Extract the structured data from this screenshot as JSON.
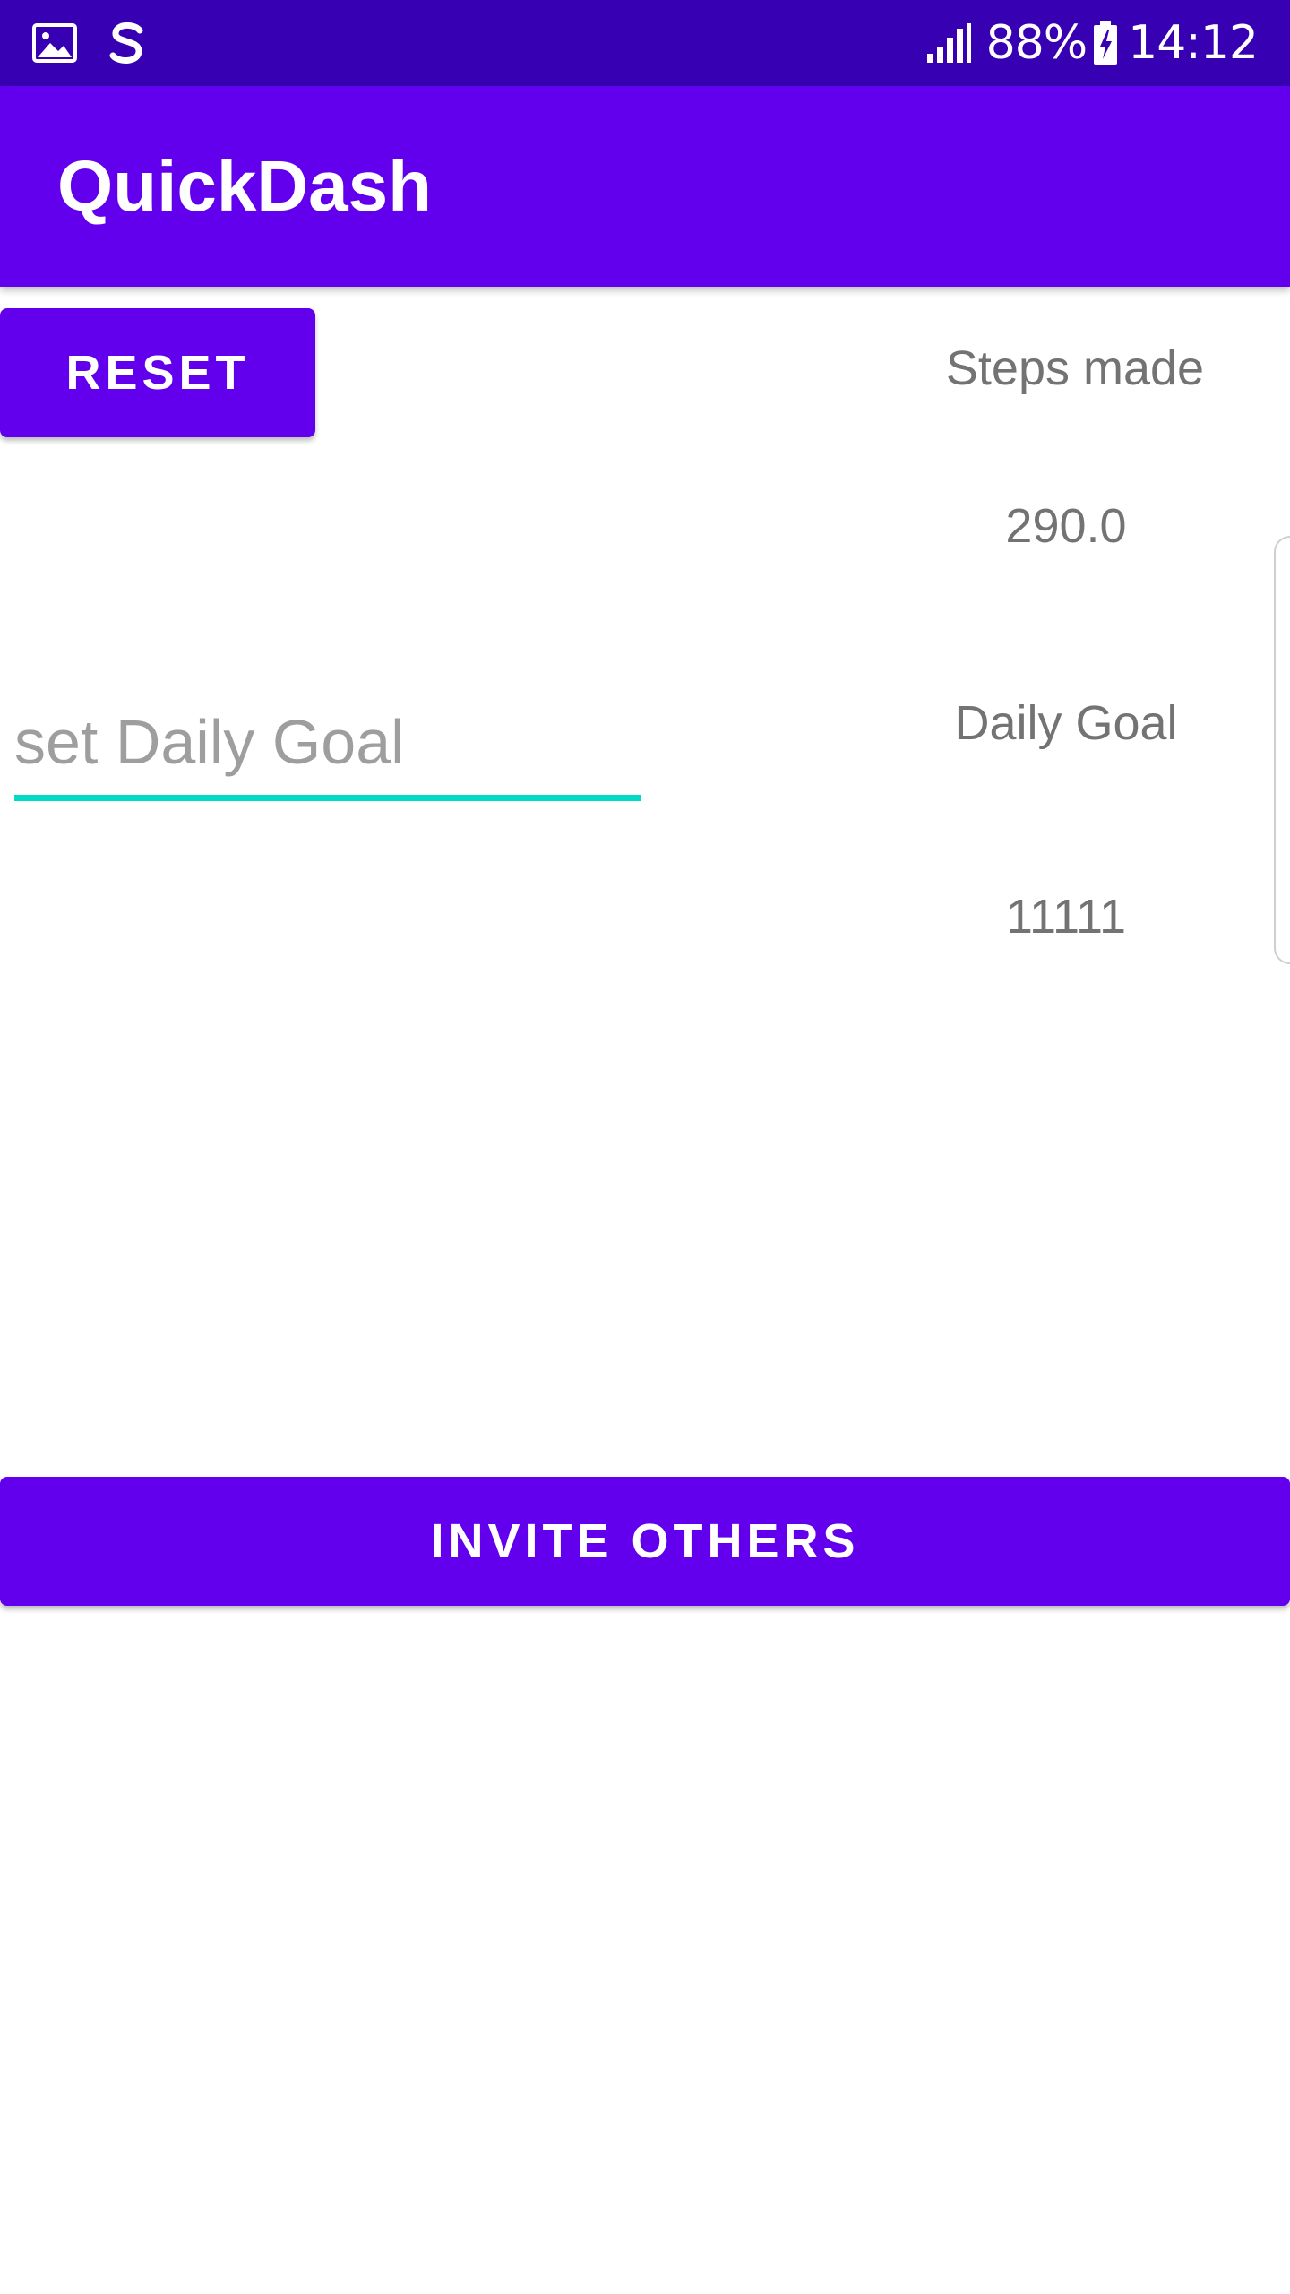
{
  "status_bar": {
    "battery_percent": "88%",
    "time": "14:12",
    "icons": [
      "gallery-icon",
      "s-app-icon",
      "signal-icon",
      "battery-charging-icon"
    ]
  },
  "app_bar": {
    "title": "QuickDash"
  },
  "main": {
    "reset_label": "RESET",
    "steps_label": "Steps made",
    "steps_value": "290.0",
    "goal_label": "Daily Goal",
    "goal_value": "11111",
    "goal_input_placeholder": "set Daily Goal",
    "goal_input_value": "",
    "invite_label": "INVITE OTHERS"
  },
  "colors": {
    "status_bar": "#3700b3",
    "primary": "#6200ee",
    "accent": "#03dac5",
    "secondary_text": "#737373",
    "hint_text": "#9e9e9e"
  }
}
